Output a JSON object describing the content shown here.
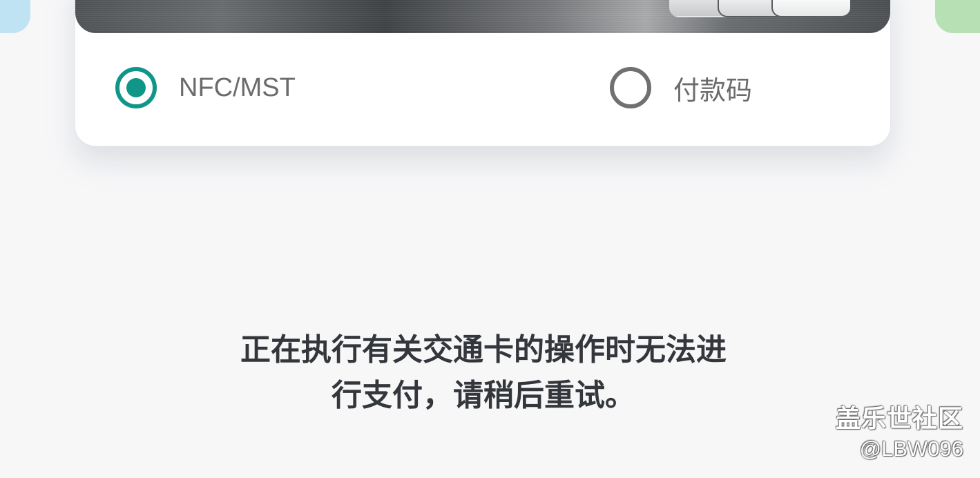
{
  "payment_options": {
    "nfc_mst": {
      "label": "NFC/MST",
      "selected": true
    },
    "payment_code": {
      "label": "付款码",
      "selected": false
    }
  },
  "message": {
    "line1": "正在执行有关交通卡的操作时无法进",
    "line2": "行支付，请稍后重试。"
  },
  "watermark": {
    "title": "盖乐世社区",
    "user": "@LBW096"
  },
  "colors": {
    "accent": "#109689",
    "unselected": "#707070",
    "message_text": "#33363b",
    "background": "#f7f7f8"
  }
}
